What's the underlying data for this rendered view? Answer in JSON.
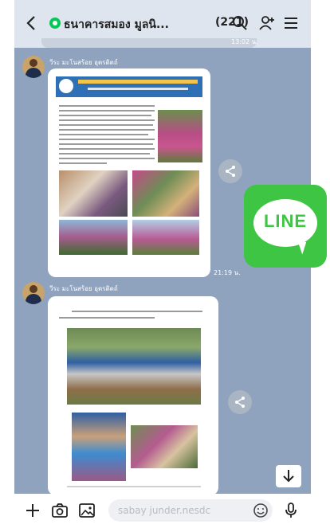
{
  "header": {
    "back_icon": "chevron-left-icon",
    "title": "ธนาคารสมอง มูลนิ...",
    "member_count": "(221)",
    "icons": [
      "search-icon",
      "add-friend-icon",
      "menu-icon"
    ]
  },
  "older_message": {
    "time": "13:02 น."
  },
  "messages": [
    {
      "sender": "วีระ มะโนสร้อย อุตรดิตถ์",
      "card": {
        "banner_title": "วุฒิอาสาธนาคารสมอง จังหวัดอุตรดิตถ์",
        "banner_subtitle": "ประจำเดือนมีนาคม ๒๕๖๘"
      },
      "time": "21:19 น."
    },
    {
      "sender": "วีระ มะโนสร้อย อุตรดิตถ์",
      "card": {}
    }
  ],
  "overlay_logo": {
    "text": "LINE",
    "color": "#3ec544"
  },
  "input_bar": {
    "icons": [
      "plus-icon",
      "camera-icon",
      "image-icon",
      "emoji-icon",
      "microphone-icon"
    ],
    "placeholder": "sabay junder.nesdc"
  },
  "colors": {
    "line_green": "#06c755",
    "chat_background": "#8fa3bf"
  }
}
